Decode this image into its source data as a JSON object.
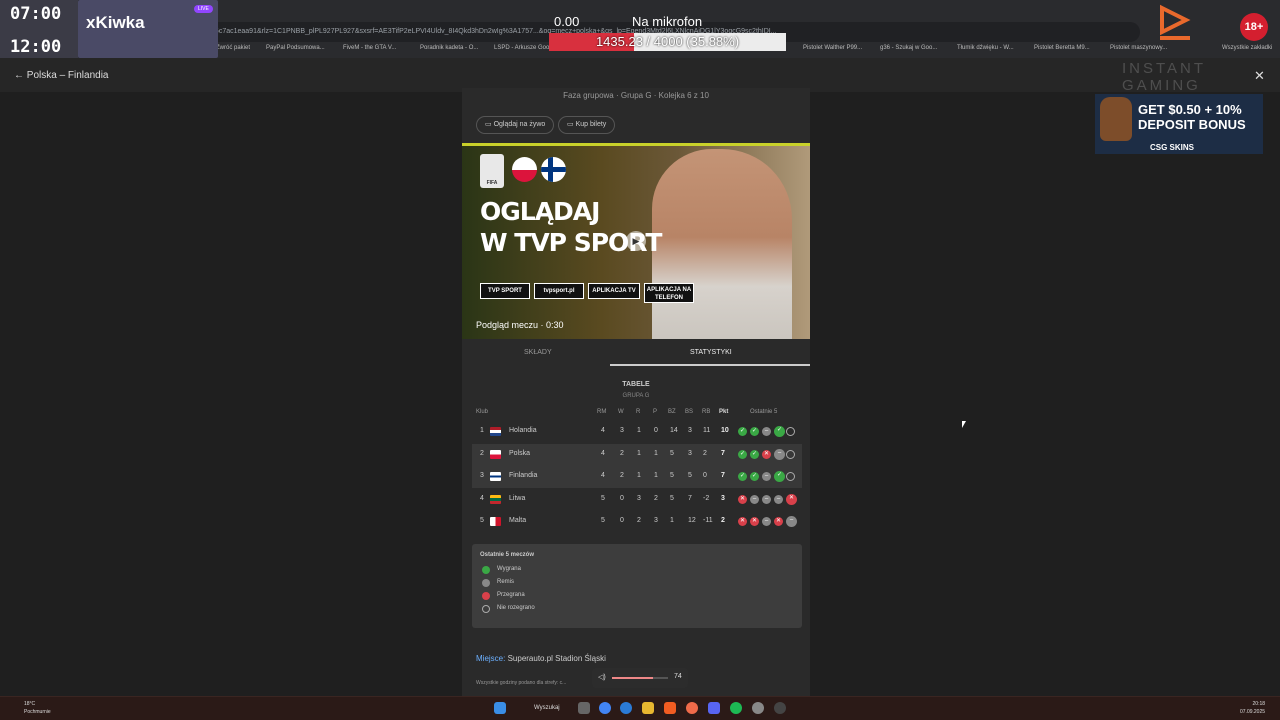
{
  "overlay": {
    "time1": "07:00",
    "time2": "12:00",
    "streamer": "xKiwka",
    "live": "LIVE"
  },
  "mic": {
    "level": "0.00",
    "label": "Na mikrofon",
    "progress_text": "1435.23 / 4000 (35.88%)",
    "progress_fraction": 0.3588
  },
  "browser": {
    "address": "...mecz+polska+&sca_esv=f92416c7ac1eaa91&rlz=1C1PNBB_plPL927PL927&sxsrf=AE3TifP2eLPVI4Uldv_8I4Qkd3hDn2wIg%3A1757...&oq=mecz+polska+&gs_lp=Egend3Mtd2l6LXNlcnAiDG1lY3ogcG9sc2thIDI...",
    "bookmarks": [
      "Zwróć pakiet",
      "PayPal Podsumowa...",
      "FiveM - the GTA V...",
      "Poradnik kadeta - O...",
      "LSPD - Arkusze Goo...",
      "Pistolet Walther P99...",
      "g36 - Szukaj w Goo...",
      "Tłumik dźwięku - W...",
      "Pistolet Beretta M9...",
      "Pistolet maszynowy...",
      "Wszystkie zakładki"
    ]
  },
  "header": {
    "back_label": "Polska – Finlandia"
  },
  "brand_watermark": "INSTANT GAMING",
  "ad": {
    "line1": "GET $0.50 + 10%",
    "line2": "DEPOSIT BONUS",
    "brand": "CSG SKINS"
  },
  "age_badge": "18+",
  "match": {
    "meta": "Faza grupowa · Grupa G · Kolejka 6 z 10",
    "watch_live": "Oglądaj na żywo",
    "buy_tickets": "Kup bilety",
    "banner_title_1": "OGLĄDAJ",
    "banner_title_2": "W TVP SPORT",
    "banner_buttons": [
      "TVP SPORT",
      "tvpsport.pl",
      "APLIKACJA TV",
      "APLIKACJA NA TELEFON"
    ],
    "preview": "Podgląd meczu · 0:30",
    "fifa": "FIFA"
  },
  "tabs": [
    "SKŁADY",
    "STATYSTYKI"
  ],
  "table": {
    "title": "TABELE",
    "subtitle": "GRUPA G",
    "headers": [
      "Klub",
      "RM",
      "W",
      "R",
      "P",
      "BZ",
      "BS",
      "RB",
      "Pkt",
      "Ostatnie 5"
    ],
    "rows": [
      {
        "pos": "1",
        "club": "Holandia",
        "rm": "4",
        "w": "3",
        "r": "1",
        "p": "0",
        "bz": "14",
        "bs": "3",
        "rb": "11",
        "pkt": "10",
        "last5": [
          "w",
          "w",
          "d",
          "w",
          "n"
        ]
      },
      {
        "pos": "2",
        "club": "Polska",
        "rm": "4",
        "w": "2",
        "r": "1",
        "p": "1",
        "bz": "5",
        "bs": "3",
        "rb": "2",
        "pkt": "7",
        "last5": [
          "w",
          "w",
          "l",
          "d",
          "n"
        ]
      },
      {
        "pos": "3",
        "club": "Finlandia",
        "rm": "4",
        "w": "2",
        "r": "1",
        "p": "1",
        "bz": "5",
        "bs": "5",
        "rb": "0",
        "pkt": "7",
        "last5": [
          "w",
          "w",
          "d",
          "w",
          "n"
        ]
      },
      {
        "pos": "4",
        "club": "Litwa",
        "rm": "5",
        "w": "0",
        "r": "3",
        "p": "2",
        "bz": "5",
        "bs": "7",
        "rb": "-2",
        "pkt": "3",
        "last5": [
          "l",
          "d",
          "d",
          "d",
          "l"
        ]
      },
      {
        "pos": "5",
        "club": "Malta",
        "rm": "5",
        "w": "0",
        "r": "2",
        "p": "3",
        "bz": "1",
        "bs": "12",
        "rb": "-11",
        "pkt": "2",
        "last5": [
          "l",
          "l",
          "d",
          "l",
          "d"
        ]
      }
    ]
  },
  "legend": {
    "title": "Ostatnie 5 meczów",
    "win": "Wygrana",
    "draw": "Remis",
    "loss": "Przegrana",
    "not_played": "Nie rozegrano"
  },
  "venue": {
    "label": "Miejsce:",
    "value": "Superauto.pl Stadion Śląski"
  },
  "note": "Wszystkie godziny podano dla strefy: c...",
  "volume": {
    "value": "74",
    "fraction": 0.74
  },
  "taskbar": {
    "search": "Wyszukaj",
    "weather_temp": "18°C",
    "weather_desc": "Pochmurnie",
    "time": "20:18",
    "date": "07.09.2025"
  },
  "colors": {
    "win": "#3aa845",
    "loss": "#d8404a",
    "draw": "#888888",
    "accent": "#c9d12a",
    "mic_fill": "#d8303e"
  }
}
